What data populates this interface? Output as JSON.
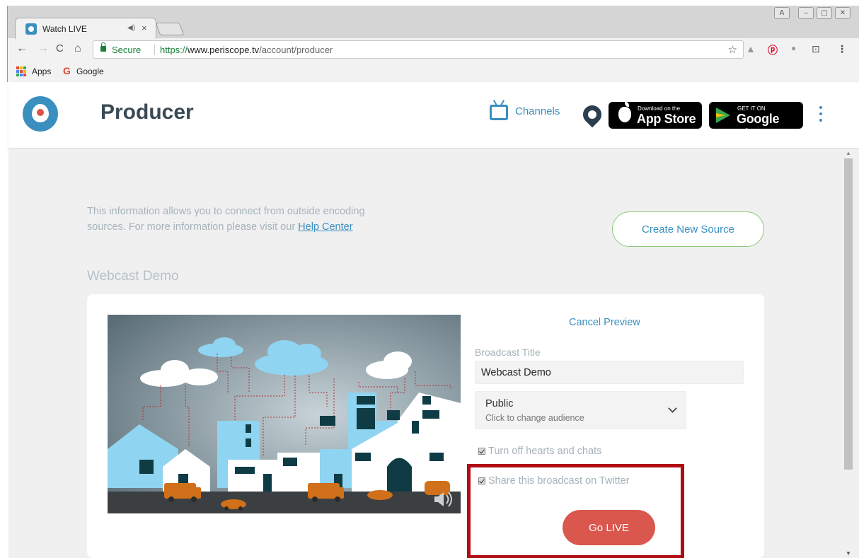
{
  "browser": {
    "tab_title": "Watch LIVE",
    "tab_audio": "◀)",
    "tab_close": "×",
    "window_buttons": [
      "A",
      "–",
      "▢",
      "✕"
    ],
    "nav": {
      "back": "←",
      "forward": "→",
      "reload": "C",
      "home": "⌂"
    },
    "omnibox": {
      "secure_label": "Secure",
      "url_proto": "https://",
      "url_host": "www.periscope.tv",
      "url_path": "/account/producer"
    },
    "star": "☆",
    "bookmarks": [
      {
        "label": "Apps",
        "icon": "apps-grid-icon"
      },
      {
        "label": "Google",
        "icon": "google-g-icon"
      }
    ]
  },
  "header": {
    "brand": "Producer",
    "channels_label": "Channels",
    "app_store": {
      "small": "Download on the",
      "big": "App Store"
    },
    "google_play": {
      "small": "GET IT ON",
      "big": "Google Play"
    }
  },
  "main": {
    "info_text_1": "This information allows you to connect from outside encoding sources. For more information please visit our ",
    "help_link": "Help Center",
    "create_button": "Create New Source",
    "section_title": "Webcast Demo",
    "cancel_preview": "Cancel Preview",
    "broadcast_title_label": "Broadcast Title",
    "broadcast_title_value": "Webcast Demo",
    "audience_main": "Public",
    "audience_sub": "Click to change audience",
    "checkbox_hearts": "Turn off hearts and chats",
    "checkbox_twitter": "Share this broadcast on Twitter",
    "golive_button": "Go LIVE"
  },
  "colors": {
    "accent": "#3a8fbf",
    "golive": "#d9574d",
    "create_border": "#8cc97a",
    "highlight": "#b00c12"
  }
}
